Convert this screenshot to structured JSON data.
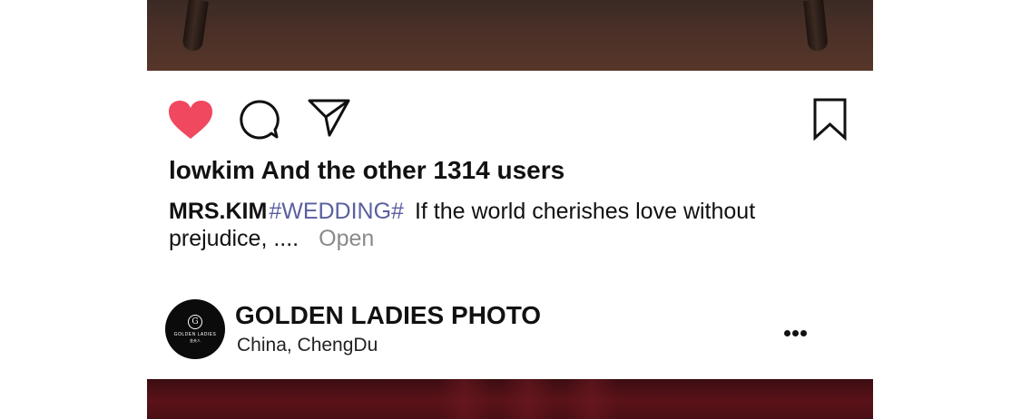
{
  "post": {
    "likes_text": "lowkim And the other 1314 users",
    "caption": {
      "author": "MRS.KIM",
      "hashtag": "#WEDDING#",
      "text": "If the world cherishes love without prejudice, ....",
      "more_label": "Open"
    },
    "icons": {
      "like": "heart-icon",
      "comment": "comment-bubble-icon",
      "share": "paper-plane-icon",
      "save": "bookmark-icon"
    },
    "colors": {
      "like_active": "#f0485e",
      "hashtag": "#5a5f9e",
      "more_link": "#8a8a8a"
    }
  },
  "next_post": {
    "account_name": "GOLDEN LADIES PHOTO",
    "location": "China,  ChengDu",
    "avatar": {
      "brand_text": "GOLDEN LADIES",
      "brand_sub": "金夫人"
    },
    "menu_icon": "more-dots-icon"
  }
}
